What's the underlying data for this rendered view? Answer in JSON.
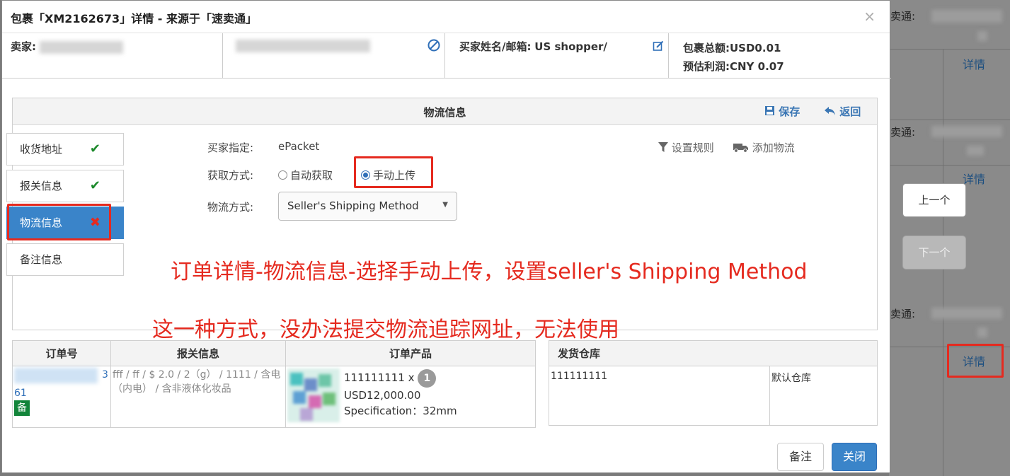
{
  "modal": {
    "title": "包裹「XM2162673」详情 - 来源于「速卖通」",
    "close_icon": "×"
  },
  "info": {
    "seller_label": "卖家:",
    "buyer_label": "买家姓名/邮箱:",
    "buyer_value": "US shopper/",
    "total_label": "包裹总额:",
    "total_value": "USD0.01",
    "profit_label": "预估利润:",
    "profit_value": "CNY 0.07"
  },
  "logistics": {
    "panel_title": "物流信息",
    "save_label": "保存",
    "back_label": "返回",
    "tabs": [
      {
        "label": "收货地址",
        "status": "✔"
      },
      {
        "label": "报关信息",
        "status": "✔"
      },
      {
        "label": "物流信息",
        "status": "✖"
      },
      {
        "label": "备注信息",
        "status": ""
      }
    ],
    "buyer_specified_label": "买家指定:",
    "buyer_specified_value": "ePacket",
    "acquire_label": "获取方式:",
    "acquire_options": [
      "自动获取",
      "手动上传"
    ],
    "acquire_selected": "手动上传",
    "method_label": "物流方式:",
    "method_value": "Seller's Shipping Method",
    "rules_label": "设置规则",
    "add_logistics_label": "添加物流"
  },
  "annotations": {
    "line1": "订单详情-物流信息-选择手动上传，设置seller's Shipping Method",
    "line2": "这一种方式，没办法提交物流追踪网址，无法使用"
  },
  "order_table": {
    "headers": [
      "订单号",
      "报关信息",
      "订单产品"
    ],
    "order_no_suffix_top": "3",
    "order_no_suffix_bottom": "61",
    "badge": "备",
    "customs_info": "fff / ff / $ 2.0 / 2（g） / 1111 / 含电（内电） / 含非液体化妆品",
    "product_sku": "111111111 x",
    "quantity": "1",
    "price": "USD12,000.00",
    "spec": "Specification：32mm"
  },
  "warehouse_table": {
    "header": "发货仓库",
    "code": "111111111",
    "name": "默认仓库"
  },
  "footer": {
    "remark_button": "备注",
    "close_button": "关闭"
  },
  "background": {
    "channel_label": "卖通:",
    "detail_label": "详情",
    "prev_button": "上一个",
    "next_button": "下一个"
  },
  "colors": {
    "accent": "#3a84c9",
    "annotation_red": "#e52a1f",
    "ok_green": "#1d8a2c",
    "badge_green": "#12843a"
  }
}
